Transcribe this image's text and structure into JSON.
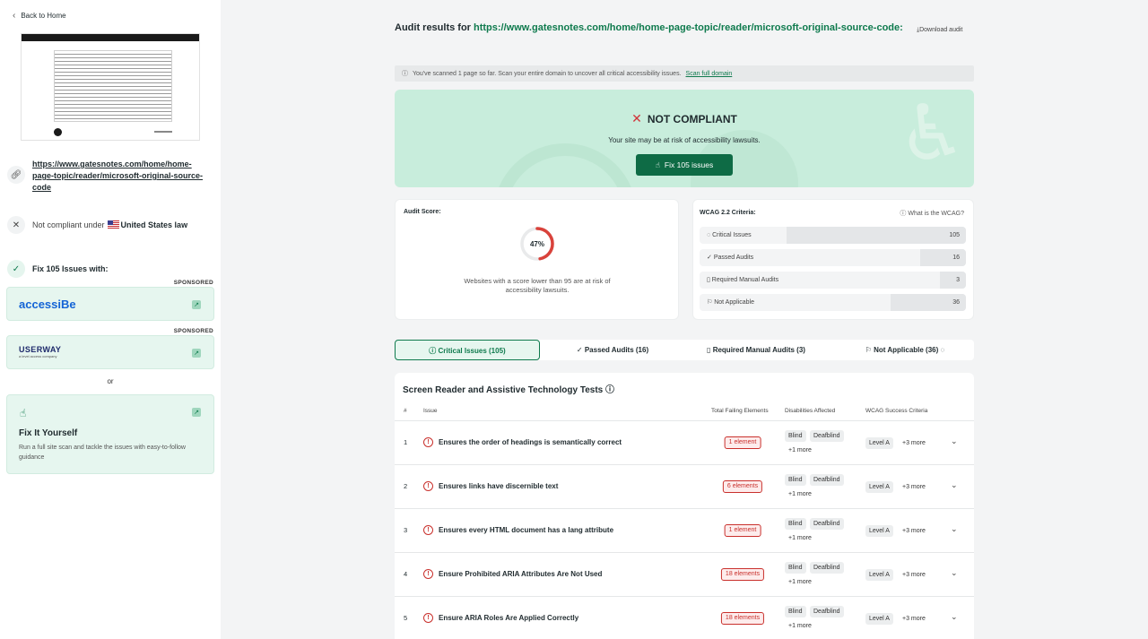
{
  "sidebar": {
    "back_label": "Back to Home",
    "url": "https://www.gatesnotes.com/home/home-page-topic/reader/microsoft-original-source-code",
    "compliance_prefix": "Not compliant under",
    "compliance_law": "United States law",
    "fix_title": "Fix 105 Issues with:",
    "sponsored_label": "SPONSORED",
    "sponsors": [
      {
        "name": "accessiBe"
      },
      {
        "name": "USERWAY",
        "tagline": "a level access company"
      }
    ],
    "or_label": "or",
    "fix_yourself": {
      "title": "Fix It Yourself",
      "description": "Run a full site scan and tackle the issues with easy-to-follow guidance"
    }
  },
  "main": {
    "results_prefix": "Audit results for",
    "results_url": "https://www.gatesnotes.com/home/home-page-topic/reader/microsoft-original-source-code:",
    "download_label": "Download audit",
    "scan_banner": {
      "text": "You've scanned 1 page so far. Scan your entire domain to uncover all critical accessibility issues.",
      "link": "Scan full domain"
    },
    "hero": {
      "status": "NOT COMPLIANT",
      "risk_text": "Your site may be at risk of accessibility lawsuits.",
      "fix_button": "Fix 105 issues"
    },
    "score": {
      "label": "Audit Score:",
      "value": 47,
      "display": "47%",
      "note": "Websites with a score lower than 95 are at risk of accessibility lawsuits."
    },
    "wcag": {
      "label": "WCAG 2.2 Criteria:",
      "what_link": "What is the WCAG?",
      "rows": [
        {
          "label": "Critical Issues",
          "count": "105",
          "value": 105
        },
        {
          "label": "Passed Audits",
          "count": "16",
          "value": 16
        },
        {
          "label": "Required Manual Audits",
          "count": "3",
          "value": 3
        },
        {
          "label": "Not Applicable",
          "count": "36",
          "value": 36
        }
      ]
    },
    "tabs": [
      {
        "label": "Critical Issues (105)"
      },
      {
        "label": "Passed Audits (16)"
      },
      {
        "label": "Required Manual Audits (3)"
      },
      {
        "label": "Not Applicable (36)"
      }
    ],
    "table": {
      "title": "Screen Reader and Assistive Technology Tests",
      "headers": {
        "num": "#",
        "issue": "Issue",
        "failing": "Total Failing Elements",
        "disabilities": "Disabilities Affected",
        "wcag": "WCAG Success Criteria"
      },
      "rows": [
        {
          "num": "1",
          "issue": "Ensures the order of headings is semantically correct",
          "count": "1 element"
        },
        {
          "num": "2",
          "issue": "Ensures links have discernible text",
          "count": "6 elements"
        },
        {
          "num": "3",
          "issue": "Ensures every HTML document has a lang attribute",
          "count": "1 element"
        },
        {
          "num": "4",
          "issue": "Ensure Prohibited ARIA Attributes Are Not Used",
          "count": "18 elements"
        },
        {
          "num": "5",
          "issue": "Ensure ARIA Roles Are Applied Correctly",
          "count": "18 elements"
        }
      ],
      "chip_blind": "Blind",
      "chip_deafblind": "Deafblind",
      "more_dis": "+1 more",
      "chip_level": "Level A",
      "more_wcag": "+3 more"
    }
  },
  "colors": {
    "accent": "#0e7a4d",
    "danger": "#c9302c",
    "hero_bg": "#c8eddc"
  }
}
